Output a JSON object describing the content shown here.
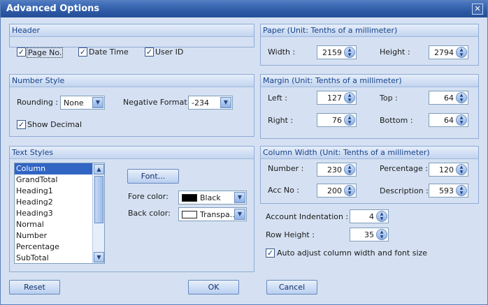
{
  "window": {
    "title": "Advanced Options",
    "close_glyph": "✕"
  },
  "header": {
    "title": "Header",
    "page_no": {
      "label": "Page No.",
      "checked": true
    },
    "date_time": {
      "label": "Date Time",
      "checked": true
    },
    "user_id": {
      "label": "User ID",
      "checked": true
    }
  },
  "paper": {
    "title": "Paper (Unit: Tenths of a millimeter)",
    "width_label": "Width :",
    "width_value": "2159",
    "height_label": "Height :",
    "height_value": "2794"
  },
  "number_style": {
    "title": "Number Style",
    "rounding_label": "Rounding :",
    "rounding_value": "None",
    "negative_label": "Negative Format :",
    "negative_value": "-234",
    "show_decimal": {
      "label": "Show Decimal",
      "checked": true
    }
  },
  "margin": {
    "title": "Margin (Unit: Tenths of a millimeter)",
    "left_label": "Left :",
    "left_value": "127",
    "top_label": "Top :",
    "top_value": "64",
    "right_label": "Right :",
    "right_value": "76",
    "bottom_label": "Bottom :",
    "bottom_value": "64"
  },
  "text_styles": {
    "title": "Text Styles",
    "items": [
      "Column",
      "GrandTotal",
      "Heading1",
      "Heading2",
      "Heading3",
      "Normal",
      "Number",
      "Percentage",
      "SubTotal"
    ],
    "selected": 0,
    "font_button": "Font...",
    "fore_label": "Fore color:",
    "fore_value": "Black",
    "fore_color": "#000000",
    "back_label": "Back color:",
    "back_value": "Transpa...",
    "back_color": "#ffffff"
  },
  "column_width": {
    "title": "Column Width (Unit: Tenths of a millimeter)",
    "number_label": "Number :",
    "number_value": "230",
    "percentage_label": "Percentage :",
    "percentage_value": "120",
    "accno_label": "Acc No :",
    "accno_value": "200",
    "description_label": "Description :",
    "description_value": "593"
  },
  "misc": {
    "indent_label": "Account Indentation :",
    "indent_value": "4",
    "row_height_label": "Row Height :",
    "row_height_value": "35",
    "auto_adjust": {
      "label": "Auto adjust column width and font size",
      "checked": true
    }
  },
  "buttons": {
    "reset": "Reset",
    "ok": "OK",
    "cancel": "Cancel"
  },
  "icons": {
    "check": "✓",
    "up": "▲",
    "down": "▼"
  }
}
